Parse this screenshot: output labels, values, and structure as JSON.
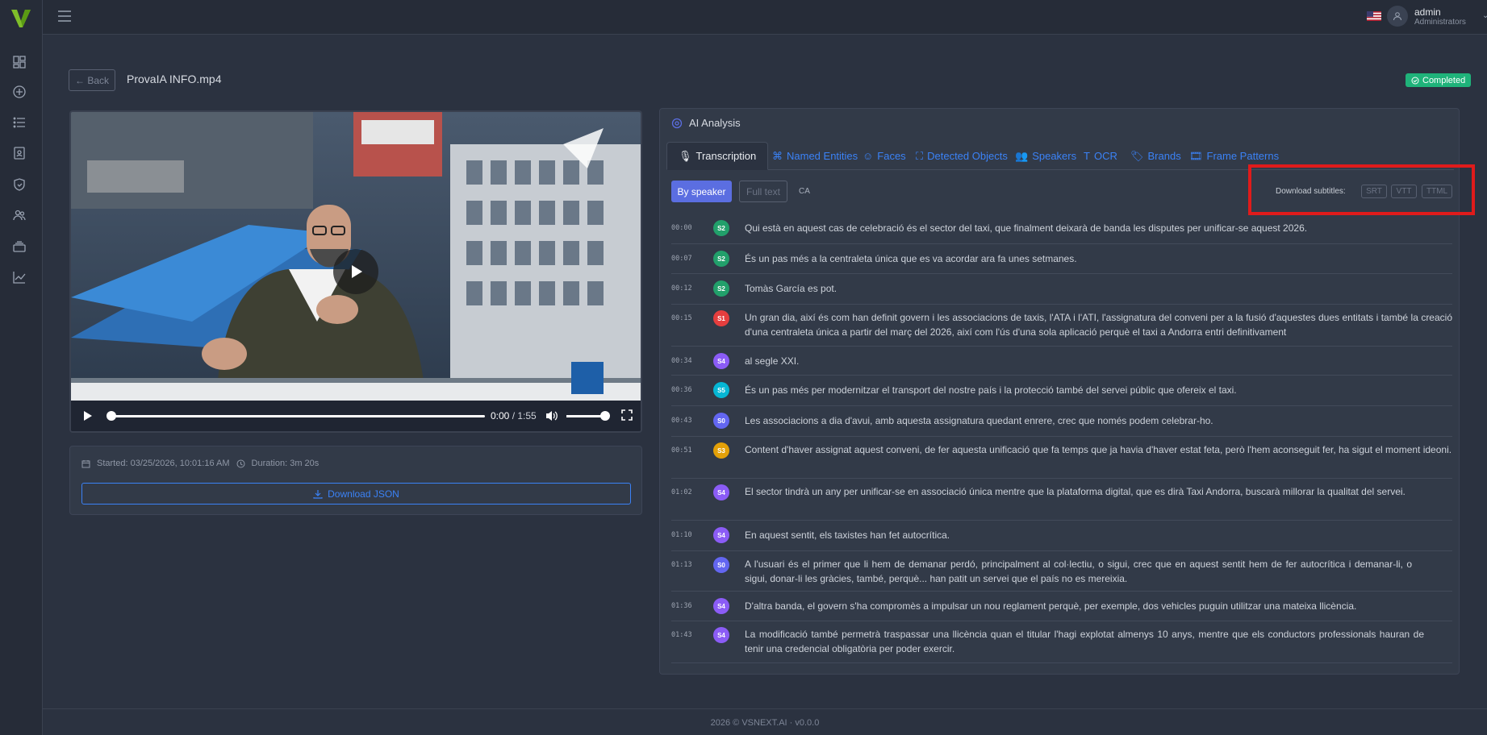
{
  "app": {
    "brand_letter": "V"
  },
  "user": {
    "name": "admin",
    "role": "Administrators"
  },
  "header": {
    "back_label": "← Back",
    "file_title": "ProvaIA INFO.mp4",
    "status": "Completed"
  },
  "video": {
    "time_current": "0:00",
    "time_sep": " / ",
    "time_total": "1:55",
    "progress": 0.0,
    "volume": 1.0
  },
  "info": {
    "started": "Started: 03/25/2026, 10:01:16 AM",
    "duration": "Duration: 3m 20s",
    "download_json": "Download JSON"
  },
  "ai": {
    "title": "AI Analysis",
    "tabs": [
      {
        "label": "Transcription",
        "icon": "mic-icon"
      },
      {
        "label": "Named Entities",
        "icon": "sitemap-icon"
      },
      {
        "label": "Faces",
        "icon": "face-icon"
      },
      {
        "label": "Detected Objects",
        "icon": "objects-icon"
      },
      {
        "label": "Speakers",
        "icon": "users-icon"
      },
      {
        "label": "OCR",
        "icon": "text-icon"
      },
      {
        "label": "Brands",
        "icon": "tag-icon"
      },
      {
        "label": "Frame Patterns",
        "icon": "film-icon"
      }
    ],
    "view_by_speaker": "By speaker",
    "view_full_text": "Full text",
    "language": "CA",
    "subtitles_label": "Download subtitles:",
    "subtitle_formats": [
      "SRT",
      "VTT",
      "TTML"
    ]
  },
  "speaker_colors": {
    "S0": "#6366f1",
    "S1": "#e53e3e",
    "S2": "#22a06b",
    "S3": "#e3a008",
    "S4": "#8b5cf6",
    "S5": "#06b6d4"
  },
  "transcript": [
    {
      "time": "00:00",
      "speaker": "S2",
      "text": "Qui està en aquest cas de celebració és el sector del taxi, que finalment deixarà de banda les disputes per unificar-se aquest 2026."
    },
    {
      "time": "00:07",
      "speaker": "S2",
      "text": "És un pas més a la centraleta única que es va acordar ara fa unes setmanes."
    },
    {
      "time": "00:12",
      "speaker": "S2",
      "text": "Tomàs García es pot."
    },
    {
      "time": "00:15",
      "speaker": "S1",
      "text": "Un gran dia, així és com han definit govern i les associacions de taxis, l'ATA i l'ATI, l'assignatura del conveni per a la fusió d'aquestes dues entitats i també la creació d'una centraleta única a partir del març del 2026, així com l'ús d'una sola aplicació perquè el taxi a Andorra entri definitivament"
    },
    {
      "time": "00:34",
      "speaker": "S4",
      "text": "al segle XXI."
    },
    {
      "time": "00:36",
      "speaker": "S5",
      "text": "És un pas més per modernitzar el transport del nostre país i la protecció també del servei públic que ofereix el taxi."
    },
    {
      "time": "00:43",
      "speaker": "S0",
      "text": "Les associacions a dia d'avui, amb aquesta assignatura quedant enrere, crec que només podem celebrar-ho."
    },
    {
      "time": "00:51",
      "speaker": "S3",
      "text": "Content d'haver assignat aquest conveni, de fer aquesta unificació que fa temps que ja havia d'haver estat feta, però l'hem aconseguit fer, ha sigut el moment ideoni."
    },
    {
      "time": "01:02",
      "speaker": "S4",
      "text": "El sector tindrà un any per unificar-se en associació única mentre que la plataforma digital, que es dirà Taxi Andorra, buscarà millorar la qualitat del servei."
    },
    {
      "time": "01:10",
      "speaker": "S4",
      "text": "En aquest sentit, els taxistes han fet autocrítica."
    },
    {
      "time": "01:13",
      "speaker": "S0",
      "text": "A l'usuari és el primer que li hem de demanar perdó, principalment al col·lectiu, o sigui, crec que en aquest sentit hem de fer autocrítica i demanar-li, o sigui, donar-li les gràcies, també, perquè... han patit un servei que el país no es mereixia."
    },
    {
      "time": "01:36",
      "speaker": "S4",
      "text": "D'altra banda, el govern s'ha compromès a impulsar un nou reglament perquè, per exemple, dos vehicles puguin utilitzar una mateixa llicència."
    },
    {
      "time": "01:43",
      "speaker": "S4",
      "text": "La modificació també permetrà traspassar una llicència quan el titular l'hagi explotat almenys 10 anys, mentre que els conductors professionals hauran de tenir una credencial obligatòria per poder exercir."
    }
  ],
  "footer": {
    "text": "2026 © VSNEXT.AI · v0.0.0"
  }
}
